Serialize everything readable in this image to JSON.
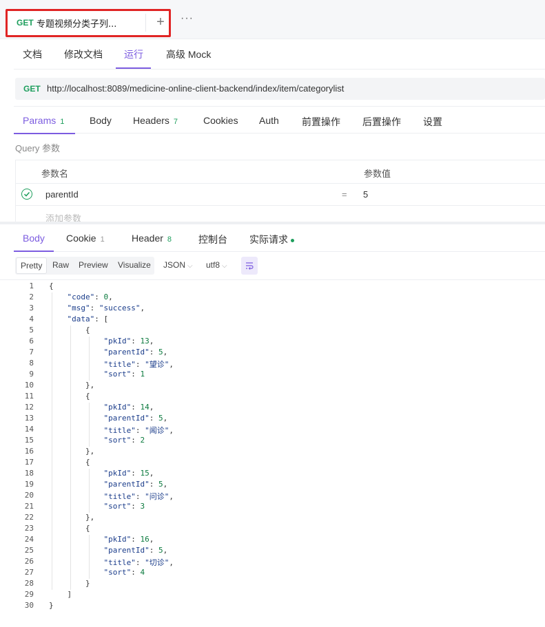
{
  "request_tab": {
    "method": "GET",
    "title": "专题视频分类子列...",
    "add_icon": "plus-icon",
    "more_icon": "ellipsis-icon"
  },
  "sub_tabs": [
    "文档",
    "修改文档",
    "运行",
    "高级 Mock"
  ],
  "active_sub_tab": "运行",
  "url_bar": {
    "method": "GET",
    "url": "http://localhost:8089/medicine-online-client-backend/index/item/categorylist"
  },
  "param_tabs": [
    {
      "label": "Params",
      "badge": "1"
    },
    {
      "label": "Body",
      "badge": ""
    },
    {
      "label": "Headers",
      "badge": "7"
    },
    {
      "label": "Cookies",
      "badge": ""
    },
    {
      "label": "Auth",
      "badge": ""
    },
    {
      "label": "前置操作",
      "badge": ""
    },
    {
      "label": "后置操作",
      "badge": ""
    },
    {
      "label": "设置",
      "badge": ""
    }
  ],
  "query": {
    "section_label": "Query 参数",
    "col_name": "参数名",
    "col_value": "参数值",
    "rows": [
      {
        "name": "parentId",
        "eq": "=",
        "value": "5",
        "enabled": true
      }
    ],
    "add_placeholder": "添加参数"
  },
  "response_tabs": [
    {
      "label": "Body",
      "badge": ""
    },
    {
      "label": "Cookie",
      "badge": "1"
    },
    {
      "label": "Header",
      "badge": "8"
    },
    {
      "label": "控制台",
      "badge": ""
    },
    {
      "label": "实际请求",
      "badge": ""
    }
  ],
  "format": {
    "modes": [
      "Pretty",
      "Raw",
      "Preview",
      "Visualize"
    ],
    "active_mode": "Pretty",
    "language": "JSON",
    "encoding": "utf8",
    "wrap_icon": "wrap-lines-icon"
  },
  "code_lines": [
    "{",
    "    \"code\": 0,",
    "    \"msg\": \"success\",",
    "    \"data\": [",
    "        {",
    "            \"pkId\": 13,",
    "            \"parentId\": 5,",
    "            \"title\": \"望诊\",",
    "            \"sort\": 1",
    "        },",
    "        {",
    "            \"pkId\": 14,",
    "            \"parentId\": 5,",
    "            \"title\": \"闻诊\",",
    "            \"sort\": 2",
    "        },",
    "        {",
    "            \"pkId\": 15,",
    "            \"parentId\": 5,",
    "            \"title\": \"问诊\",",
    "            \"sort\": 3",
    "        },",
    "        {",
    "            \"pkId\": 16,",
    "            \"parentId\": 5,",
    "            \"title\": \"切诊\",",
    "            \"sort\": 4",
    "        }",
    "    ]",
    "}"
  ],
  "colors": {
    "accent": "#7c5ce0",
    "get_method": "#1d9e5c",
    "highlight_box": "#e02424"
  }
}
